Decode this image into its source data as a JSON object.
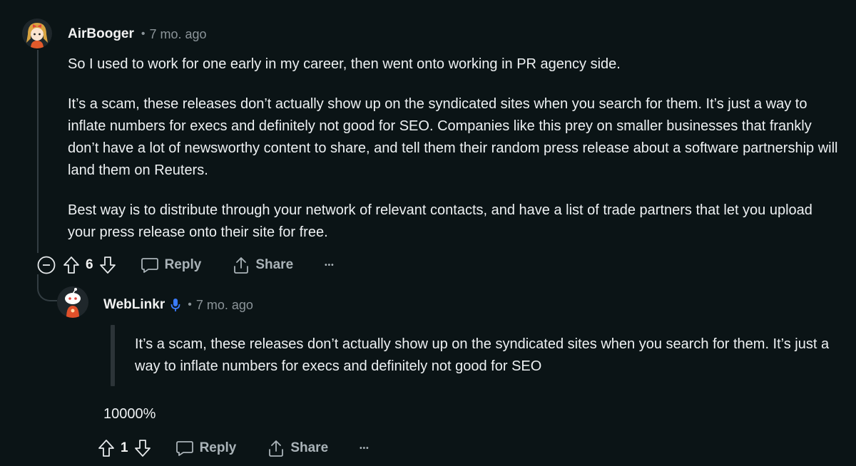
{
  "comments": [
    {
      "username": "AirBooger",
      "separator": "•",
      "time": "7 mo. ago",
      "paragraphs": [
        "So I used to work for one early in my career, then went onto working in PR agency side.",
        "It’s a scam, these releases don’t actually show up on the syndicated sites when you search for them. It’s just a way to inflate numbers for execs and definitely not good for SEO. Companies like this prey on smaller businesses that frankly don’t have a lot of newsworthy content to share, and tell them their random press release about a software partnership will land them on Reuters.",
        "Best way is to distribute through your network of relevant contacts, and have a list of trade partners that let you upload your press release onto their site for free."
      ],
      "votes": "6",
      "reply_label": "Reply",
      "share_label": "Share",
      "more_label": "•••"
    },
    {
      "username": "WebLinkr",
      "separator": "•",
      "time": "7 mo. ago",
      "quote": "It’s a scam, these releases don’t actually show up on the syndicated sites when you search for them. It’s just a way to inflate numbers for execs and definitely not good for SEO",
      "reply_text": "10000%",
      "votes": "1",
      "reply_label": "Reply",
      "share_label": "Share",
      "more_label": "•••"
    }
  ],
  "colors": {
    "background": "#0b1416",
    "text": "#eef1f3",
    "muted": "#8b9499",
    "thread_line": "#333d42",
    "mic_badge": "#3a7bff"
  },
  "icons": [
    "collapse-icon",
    "upvote-icon",
    "downvote-icon",
    "reply-icon",
    "share-icon",
    "more-icon",
    "mic-icon",
    "avatar"
  ]
}
